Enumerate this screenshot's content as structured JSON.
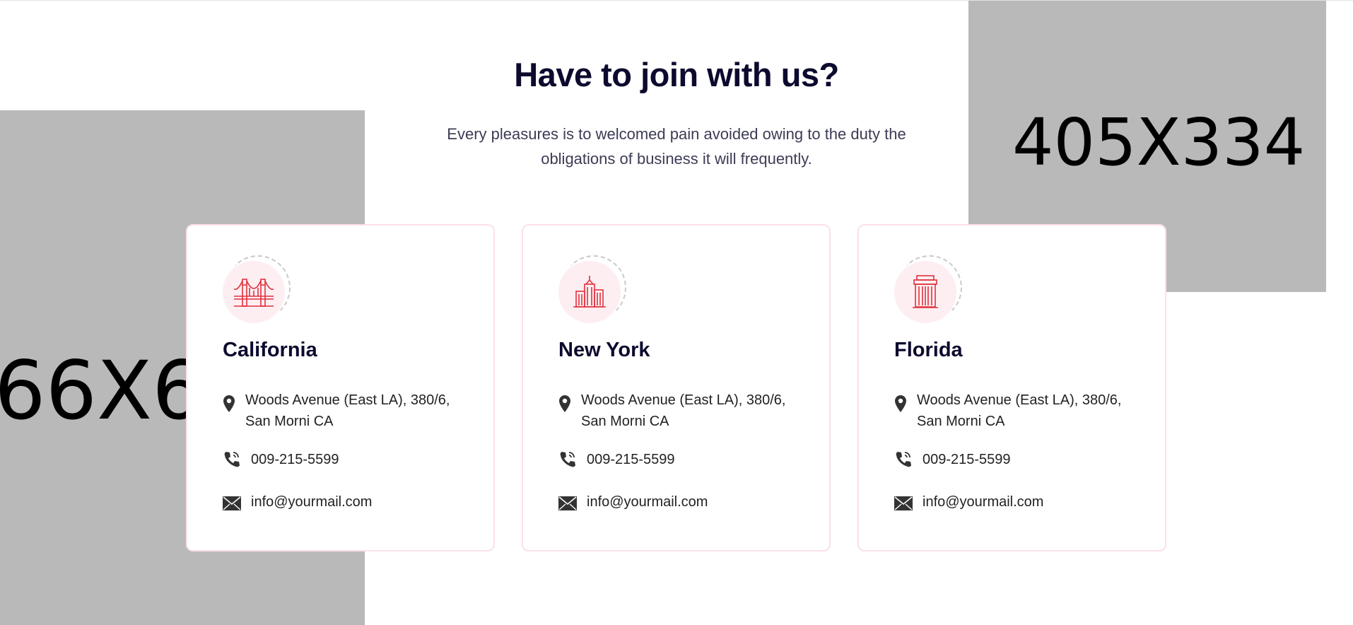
{
  "placeholders": {
    "left_label": "66X6",
    "right_label": "405X334"
  },
  "section": {
    "heading": "Have to join with us?",
    "subtitle": "Every pleasures is to welcomed pain avoided owing to the duty the obligations of business it will frequently."
  },
  "cards": [
    {
      "icon": "golden-gate-bridge-icon",
      "title": "California",
      "address": "Woods Avenue (East LA), 380/6, San Morni CA",
      "phone": "009-215-5599",
      "email": "info@yourmail.com"
    },
    {
      "icon": "city-skyline-icon",
      "title": "New York",
      "address": "Woods Avenue (East LA), 380/6, San Morni CA",
      "phone": "009-215-5599",
      "email": "info@yourmail.com"
    },
    {
      "icon": "building-icon",
      "title": "Florida",
      "address": "Woods Avenue (East LA), 380/6, San Morni CA",
      "phone": "009-215-5599",
      "email": "info@yourmail.com"
    }
  ],
  "colors": {
    "heading": "#0c0a2e",
    "accent": "#e0323f",
    "card_border": "#fbe1e6",
    "icon_bg": "#fdeef1",
    "placeholder": "#b9b9b9"
  }
}
